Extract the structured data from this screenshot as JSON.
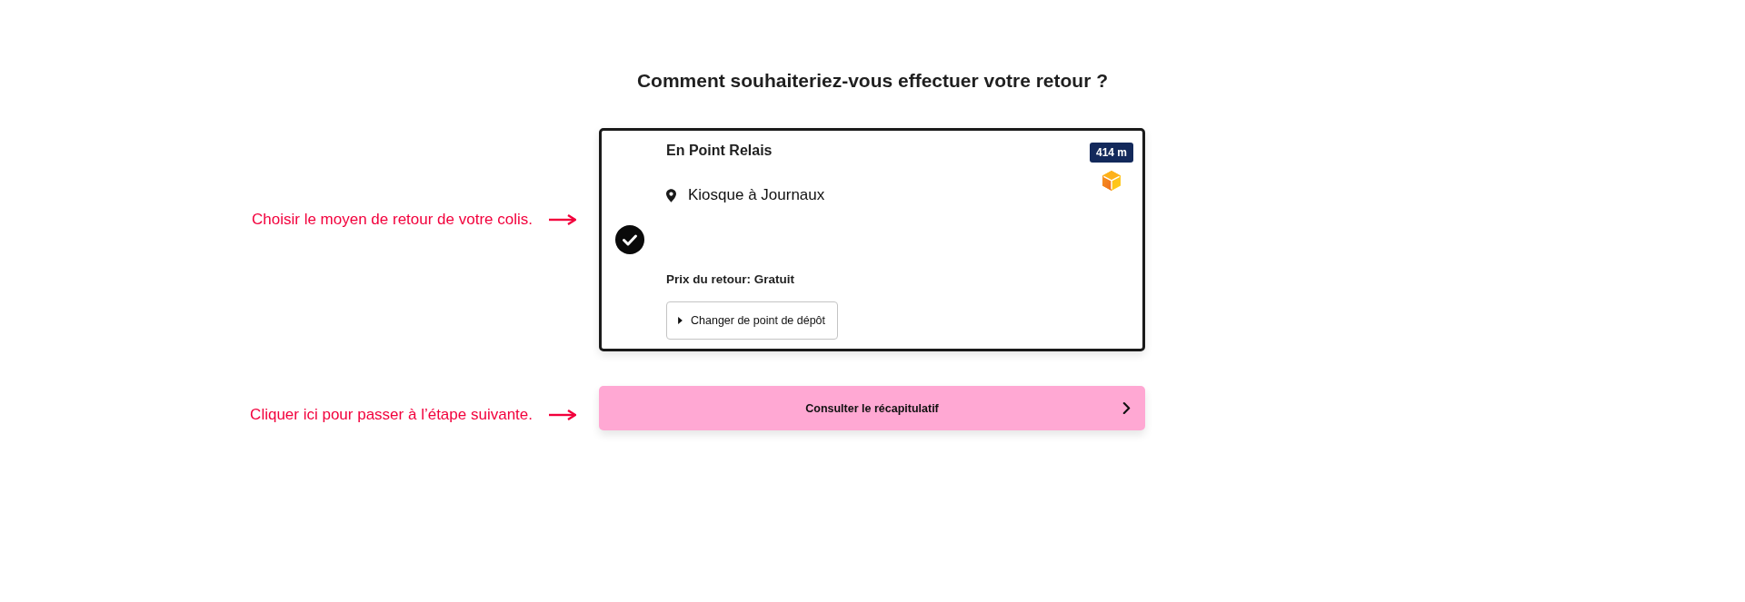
{
  "title": "Comment souhaiteriez-vous effectuer votre retour ?",
  "annotations": [
    {
      "text": "Choisir le moyen de retour de votre colis."
    },
    {
      "text": "Cliquer ici pour passer à l’étape suivante."
    }
  ],
  "options": [
    {
      "title": "En Point Relais",
      "location": "Kiosque à Journaux",
      "price": "Prix du retour: Gratuit",
      "change_button": "Changer de point de dépôt",
      "distance": "414 m",
      "selected": true
    }
  ],
  "next_button": {
    "label": "Consulter le récapitulatif"
  }
}
